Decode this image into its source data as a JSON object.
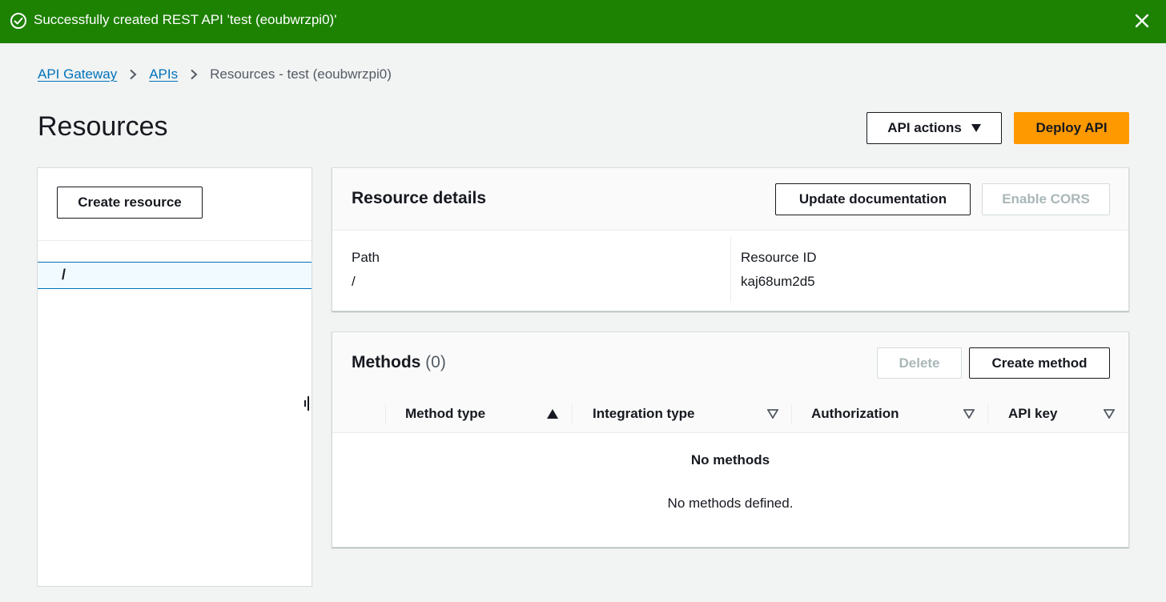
{
  "flash": {
    "message": "Successfully created REST API 'test (eoubwrzpi0)'",
    "type": "success",
    "color": "#1d8102"
  },
  "breadcrumb": {
    "items": [
      "API Gateway",
      "APIs"
    ],
    "current": "Resources - test (eoubwrzpi0)"
  },
  "page": {
    "title": "Resources",
    "api_actions_label": "API actions",
    "deploy_label": "Deploy API",
    "accent": "#ff9900",
    "link_color": "#0073bb"
  },
  "left_panel": {
    "create_resource_label": "Create resource",
    "tree": [
      {
        "path": "/",
        "selected": true
      }
    ]
  },
  "resource_details": {
    "title": "Resource details",
    "update_doc_label": "Update documentation",
    "enable_cors_label": "Enable CORS",
    "path_label": "Path",
    "path_value": "/",
    "resource_id_label": "Resource ID",
    "resource_id_value": "kaj68um2d5"
  },
  "methods": {
    "title": "Methods",
    "count": "(0)",
    "delete_label": "Delete",
    "create_label": "Create method",
    "columns": [
      "Method type",
      "Integration type",
      "Authorization",
      "API key"
    ],
    "empty_title": "No methods",
    "empty_desc": "No methods defined."
  }
}
